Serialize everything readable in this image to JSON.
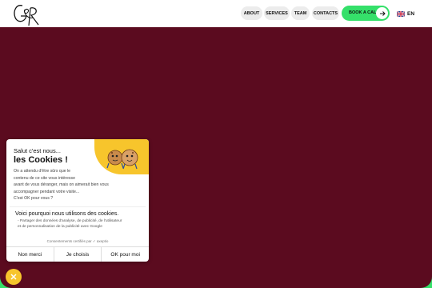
{
  "header": {
    "logo_text": "G&R",
    "nav": [
      {
        "label": "About"
      },
      {
        "label": "Services"
      },
      {
        "label": "Team"
      },
      {
        "label": "Contacts"
      }
    ],
    "cta_label": "Book a call",
    "language": "EN"
  },
  "cookie_banner": {
    "title_line1": "Salut c'est nous...",
    "title_line2": "les Cookies !",
    "body_lines": [
      "On a attendu d'être sûrs que le",
      "contenu de ce site vous intéresse",
      "avant de vous déranger, mais on aimerait bien vous",
      "accompagner pendant votre visite...",
      "C'est OK pour vous ?"
    ],
    "why_title": "Voici pourquoi nous utilisons des cookies.",
    "why_items": [
      "- Partager des données d'analyse, de publicité, de l'utilisateur",
      "et de personnalisation de la publicité avec Google"
    ],
    "certified_text": "Consentements certifiés par ✓ axeptio",
    "buttons": {
      "refuse": "Non merci",
      "choose": "Je choisis",
      "accept": "OK pour moi"
    }
  },
  "colors": {
    "background": "#5b0b1f",
    "accent_green": "#35e06a",
    "accent_yellow": "#f7c52c"
  }
}
